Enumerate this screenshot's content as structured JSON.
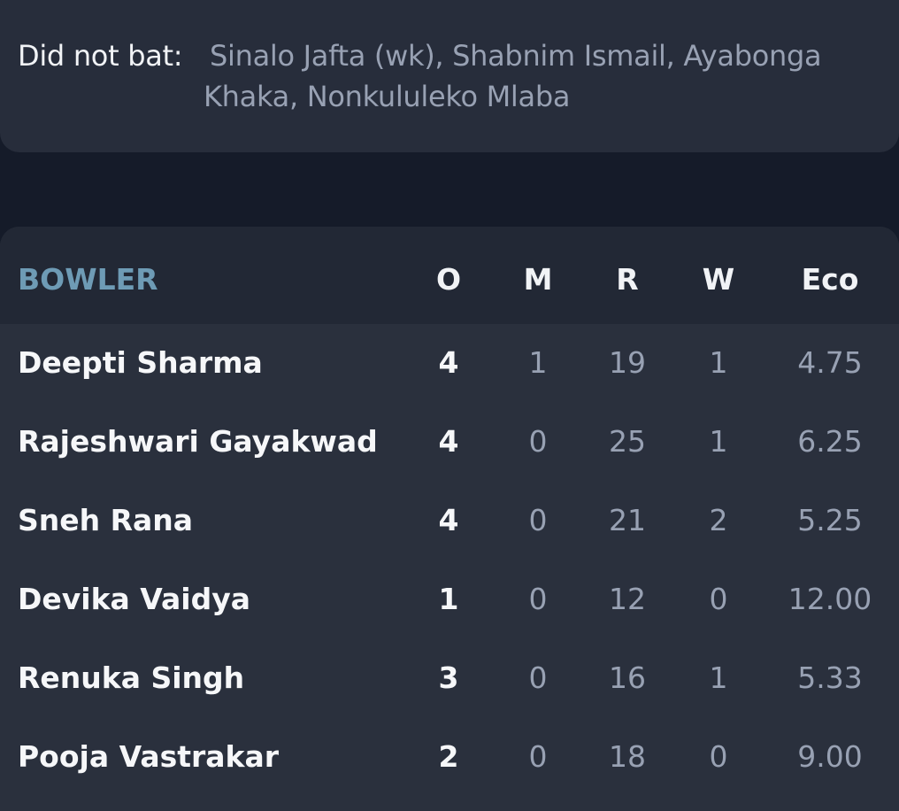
{
  "did_not_bat": {
    "label": "Did not bat:",
    "names": "Sinalo Jafta (wk), Shabnim Ismail, Ayabonga Khaka, Nonkululeko Mlaba"
  },
  "bowling": {
    "headers": {
      "bowler": "BOWLER",
      "overs": "O",
      "maidens": "M",
      "runs": "R",
      "wickets": "W",
      "economy": "Eco"
    },
    "rows": [
      {
        "name": "Deepti Sharma",
        "o": "4",
        "m": "1",
        "r": "19",
        "w": "1",
        "eco": "4.75"
      },
      {
        "name": "Rajeshwari Gayakwad",
        "o": "4",
        "m": "0",
        "r": "25",
        "w": "1",
        "eco": "6.25"
      },
      {
        "name": "Sneh Rana",
        "o": "4",
        "m": "0",
        "r": "21",
        "w": "2",
        "eco": "5.25"
      },
      {
        "name": "Devika Vaidya",
        "o": "1",
        "m": "0",
        "r": "12",
        "w": "0",
        "eco": "12.00"
      },
      {
        "name": "Renuka Singh",
        "o": "3",
        "m": "0",
        "r": "16",
        "w": "1",
        "eco": "5.33"
      },
      {
        "name": "Pooja Vastrakar",
        "o": "2",
        "m": "0",
        "r": "18",
        "w": "0",
        "eco": "9.00"
      }
    ]
  }
}
